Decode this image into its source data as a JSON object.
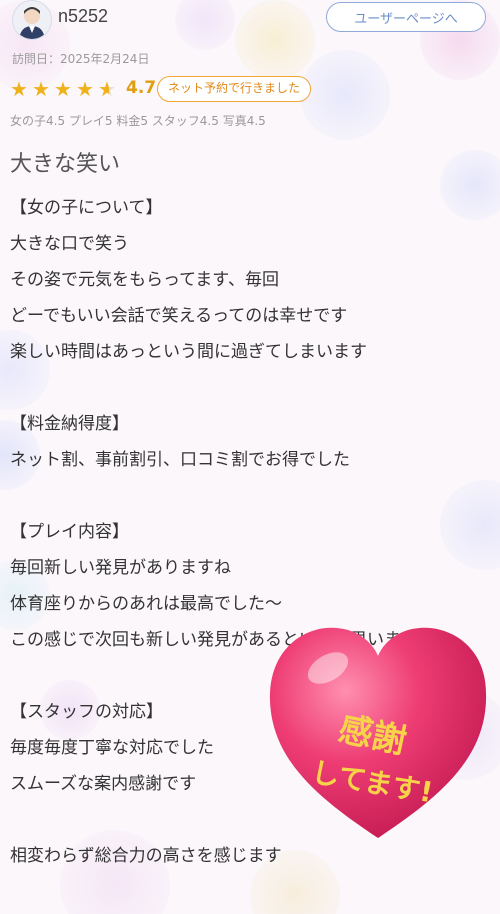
{
  "header": {
    "username": "n5252",
    "user_page_label": "ユーザーページへ",
    "visit_date": "訪問日：2025年2月24日"
  },
  "rating": {
    "value": 4.7,
    "value_label": "4.7",
    "stars": 4.5,
    "badge": "ネット予約で行きました",
    "subscores": "女の子4.5 プレイ5 料金5 スタッフ4.5 写真4.5"
  },
  "review": {
    "title": "大きな笑い",
    "girl_heading": "【女の子について】",
    "girl_lines": [
      "大きな口で笑う",
      "その姿で元気をもらってます、毎回",
      "どーでもいい会話で笑えるってのは幸せです",
      "楽しい時間はあっという間に過ぎてしまいます"
    ],
    "price_heading": "【料金納得度】",
    "price_lines": [
      "ネット割、事前割引、口コミ割でお得でした"
    ],
    "play_heading": "【プレイ内容】",
    "play_lines": [
      "毎回新しい発見がありますね",
      "体育座りからのあれは最高でした～",
      "この感じで次回も新しい発見があるといいな思います"
    ],
    "staff_heading": "【スタッフの対応】",
    "staff_lines": [
      "毎度毎度丁寧な対応でした",
      "スムーズな案内感謝です"
    ],
    "closing": "相変わらず総合力の高さを感じます"
  },
  "stamp": {
    "text_line1": "感謝",
    "text_line2": "してます!",
    "heart_color": "#e8336d"
  }
}
